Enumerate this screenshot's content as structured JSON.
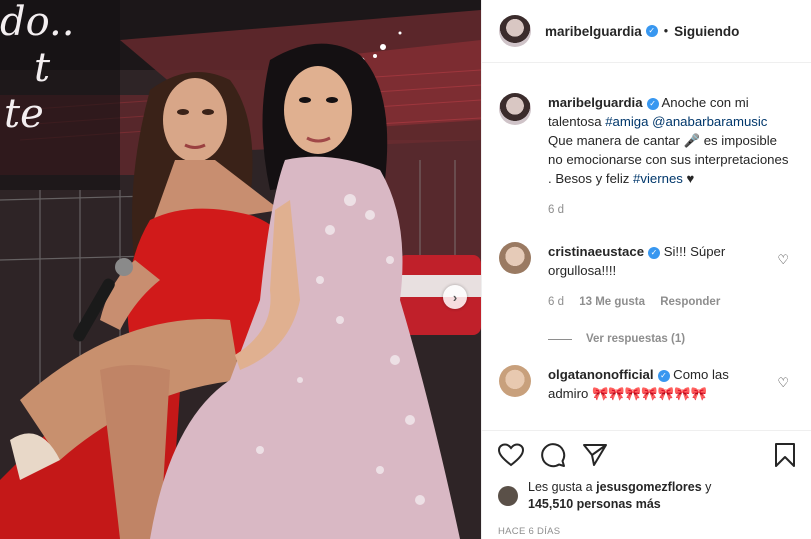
{
  "post": {
    "username": "maribelguardia",
    "follow_status": "Siguiendo",
    "dot": "•",
    "caption_parts": {
      "text1": "Anoche con mi talentosa ",
      "tag1": "#amiga",
      "space": " ",
      "mention": "@anabarbaramusic",
      "text2": " Que manera de cantar 🎤 es imposible no emocionarse con sus interpretaciones . Besos y feliz ",
      "tag2": "#viernes",
      "text3": " ♥"
    },
    "caption_time": "6 d",
    "photo_text": [
      "do..",
      "t",
      "te"
    ]
  },
  "comments": [
    {
      "username": "cristinaeustace",
      "text": " Si!!! Súper orgullosa!!!!",
      "time": "6 d",
      "likes": "13 Me gusta",
      "reply": "Responder",
      "view_replies": "Ver respuestas (1)"
    },
    {
      "username": "olgatanonofficial",
      "text": " Como las admiro ",
      "emojis": "🎀🎀🎀🎀🎀🎀🎀"
    }
  ],
  "likes": {
    "prefix": "Les gusta a ",
    "user": "jesusgomezflores",
    "mid": " y ",
    "count": "145,510 personas más"
  },
  "time_ago": "HACE 6 DÍAS",
  "icons": {
    "heart": "heart-icon",
    "comment": "comment-icon",
    "share": "share-icon",
    "save": "bookmark-icon",
    "verified": "verified-icon",
    "next": "chevron-right-icon"
  },
  "colors": {
    "link": "#00376b",
    "verified": "#3897f0",
    "muted": "#8e8e8e",
    "dress_red": "#d11a1a",
    "gown_pink": "#d9b8c4"
  }
}
